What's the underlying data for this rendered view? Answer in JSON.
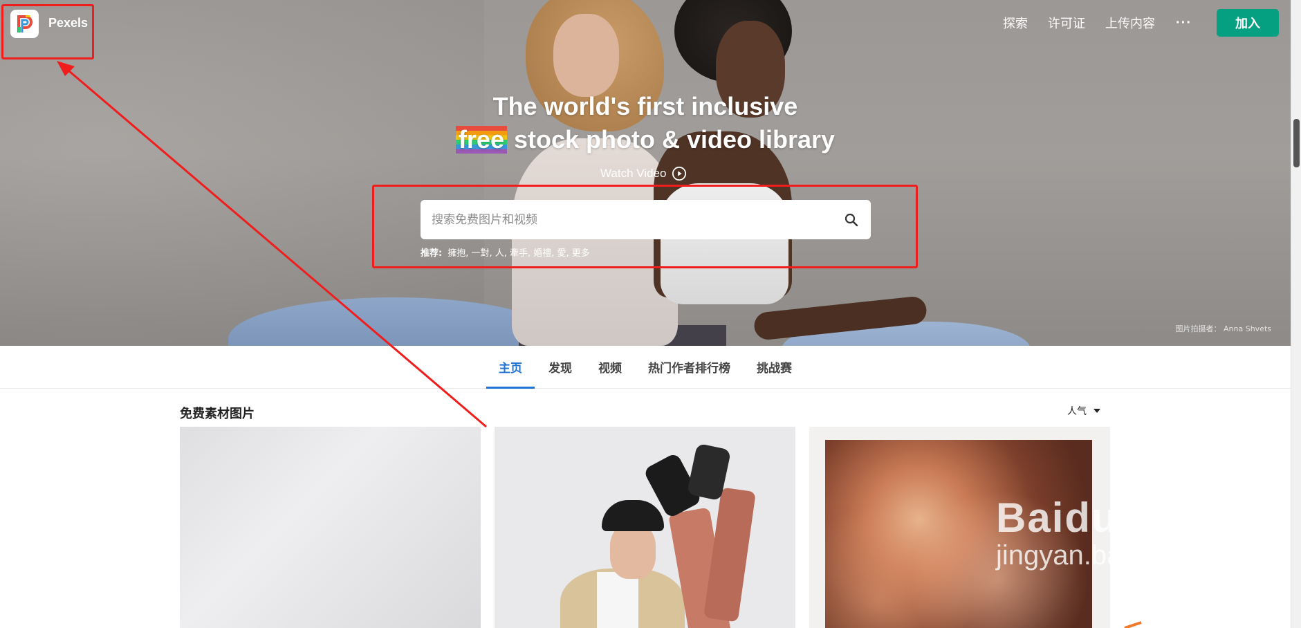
{
  "header": {
    "brand": "Pexels",
    "nav": [
      "探索",
      "许可证",
      "上传内容"
    ],
    "more": "···",
    "join_label": "加入"
  },
  "hero": {
    "title_line1": "The world's first inclusive",
    "title_free": "free",
    "title_line2_rest": " stock photo & video library",
    "watch_video": "Watch Video",
    "search_placeholder": "搜索免费图片和视频",
    "suggest_label": "推荐:",
    "suggestions": "擁抱, 一對, 人, 牽手, 婚禮, 愛, 更多",
    "credit": "图片拍摄者： Anna Shvets"
  },
  "tabs": [
    "主页",
    "发现",
    "视频",
    "热门作者排行榜",
    "挑战赛"
  ],
  "active_tab": 0,
  "content": {
    "section_title": "免费素材图片",
    "sort_label": "人气"
  },
  "watermark": {
    "main": "Baidu经验",
    "sub": "jingyan.baidu.com"
  },
  "colors": {
    "accent_green": "#05a081",
    "tab_active": "#1e72d4",
    "annotation_red": "#f01d1d"
  }
}
